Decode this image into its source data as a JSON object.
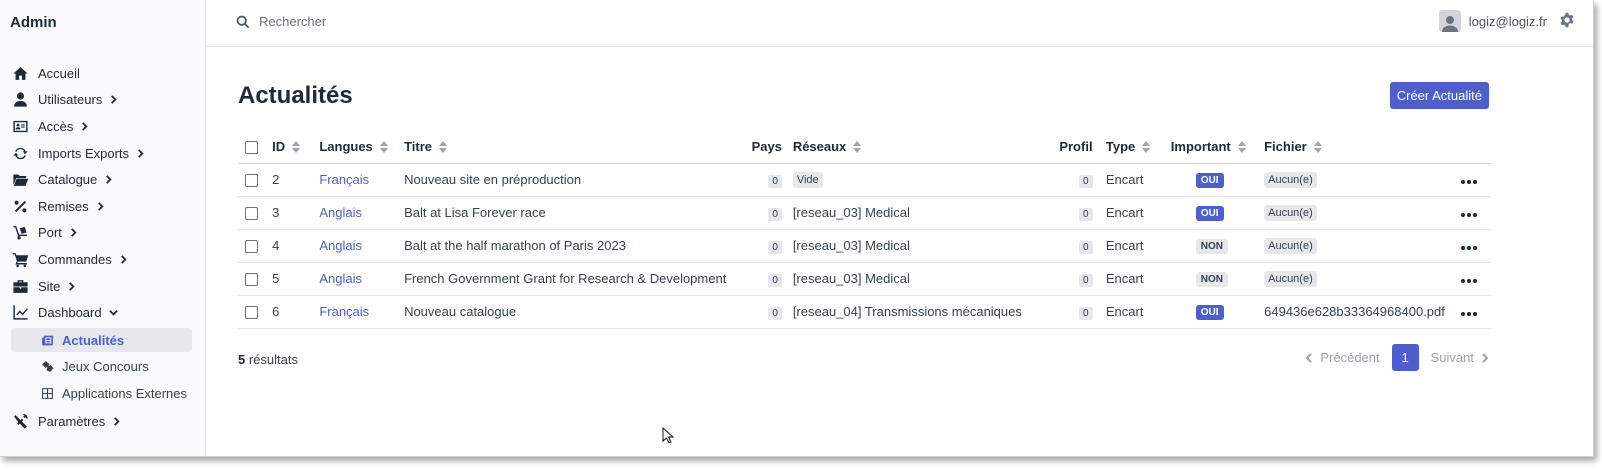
{
  "sidebar": {
    "brand": "Admin",
    "items": [
      {
        "label": "Accueil"
      },
      {
        "label": "Utilisateurs"
      },
      {
        "label": "Accès"
      },
      {
        "label": "Imports Exports"
      },
      {
        "label": "Catalogue"
      },
      {
        "label": "Remises"
      },
      {
        "label": "Port"
      },
      {
        "label": "Commandes"
      },
      {
        "label": "Site"
      },
      {
        "label": "Dashboard"
      },
      {
        "label": "Paramètres"
      }
    ],
    "subitems": [
      {
        "label": "Actualités"
      },
      {
        "label": "Jeux Concours"
      },
      {
        "label": "Applications Externes"
      }
    ]
  },
  "topbar": {
    "search_placeholder": "Rechercher",
    "user_email": "logiz@logiz.fr"
  },
  "page": {
    "title": "Actualités",
    "create_button": "Créer Actualité"
  },
  "table": {
    "headers": {
      "id": "ID",
      "langues": "Langues",
      "titre": "Titre",
      "pays": "Pays",
      "reseaux": "Réseaux",
      "profil": "Profil",
      "type": "Type",
      "important": "Important",
      "fichier": "Fichier"
    },
    "rows": [
      {
        "id": "2",
        "langue": "Français",
        "titre": "Nouveau site en préproduction",
        "pays": "0",
        "reseaux": "Vide",
        "profil": "0",
        "type": "Encart",
        "important": "OUI",
        "fichier": "Aucun(e)"
      },
      {
        "id": "3",
        "langue": "Anglais",
        "titre": "Balt at Lisa Forever race",
        "pays": "0",
        "reseaux": "[reseau_03] Medical",
        "profil": "0",
        "type": "Encart",
        "important": "OUI",
        "fichier": "Aucun(e)"
      },
      {
        "id": "4",
        "langue": "Anglais",
        "titre": "Balt at the half marathon of Paris 2023",
        "pays": "0",
        "reseaux": "[reseau_03] Medical",
        "profil": "0",
        "type": "Encart",
        "important": "NON",
        "fichier": "Aucun(e)"
      },
      {
        "id": "5",
        "langue": "Anglais",
        "titre": "French Government Grant for Research & Development",
        "pays": "0",
        "reseaux": "[reseau_03] Medical",
        "profil": "0",
        "type": "Encart",
        "important": "NON",
        "fichier": "Aucun(e)"
      },
      {
        "id": "6",
        "langue": "Français",
        "titre": "Nouveau catalogue",
        "pays": "0",
        "reseaux": "[reseau_04] Transmissions mécaniques",
        "profil": "0",
        "type": "Encart",
        "important": "OUI",
        "fichier": "649436e628b33364968400.pdf"
      }
    ]
  },
  "footer": {
    "results_count": "5",
    "results_label": "résultats",
    "prev_label": "Précédent",
    "current_page": "1",
    "next_label": "Suivant"
  },
  "colors": {
    "accent": "#4f5fc9",
    "sidebar_bg": "#f9fafb",
    "text": "#1f2937"
  }
}
